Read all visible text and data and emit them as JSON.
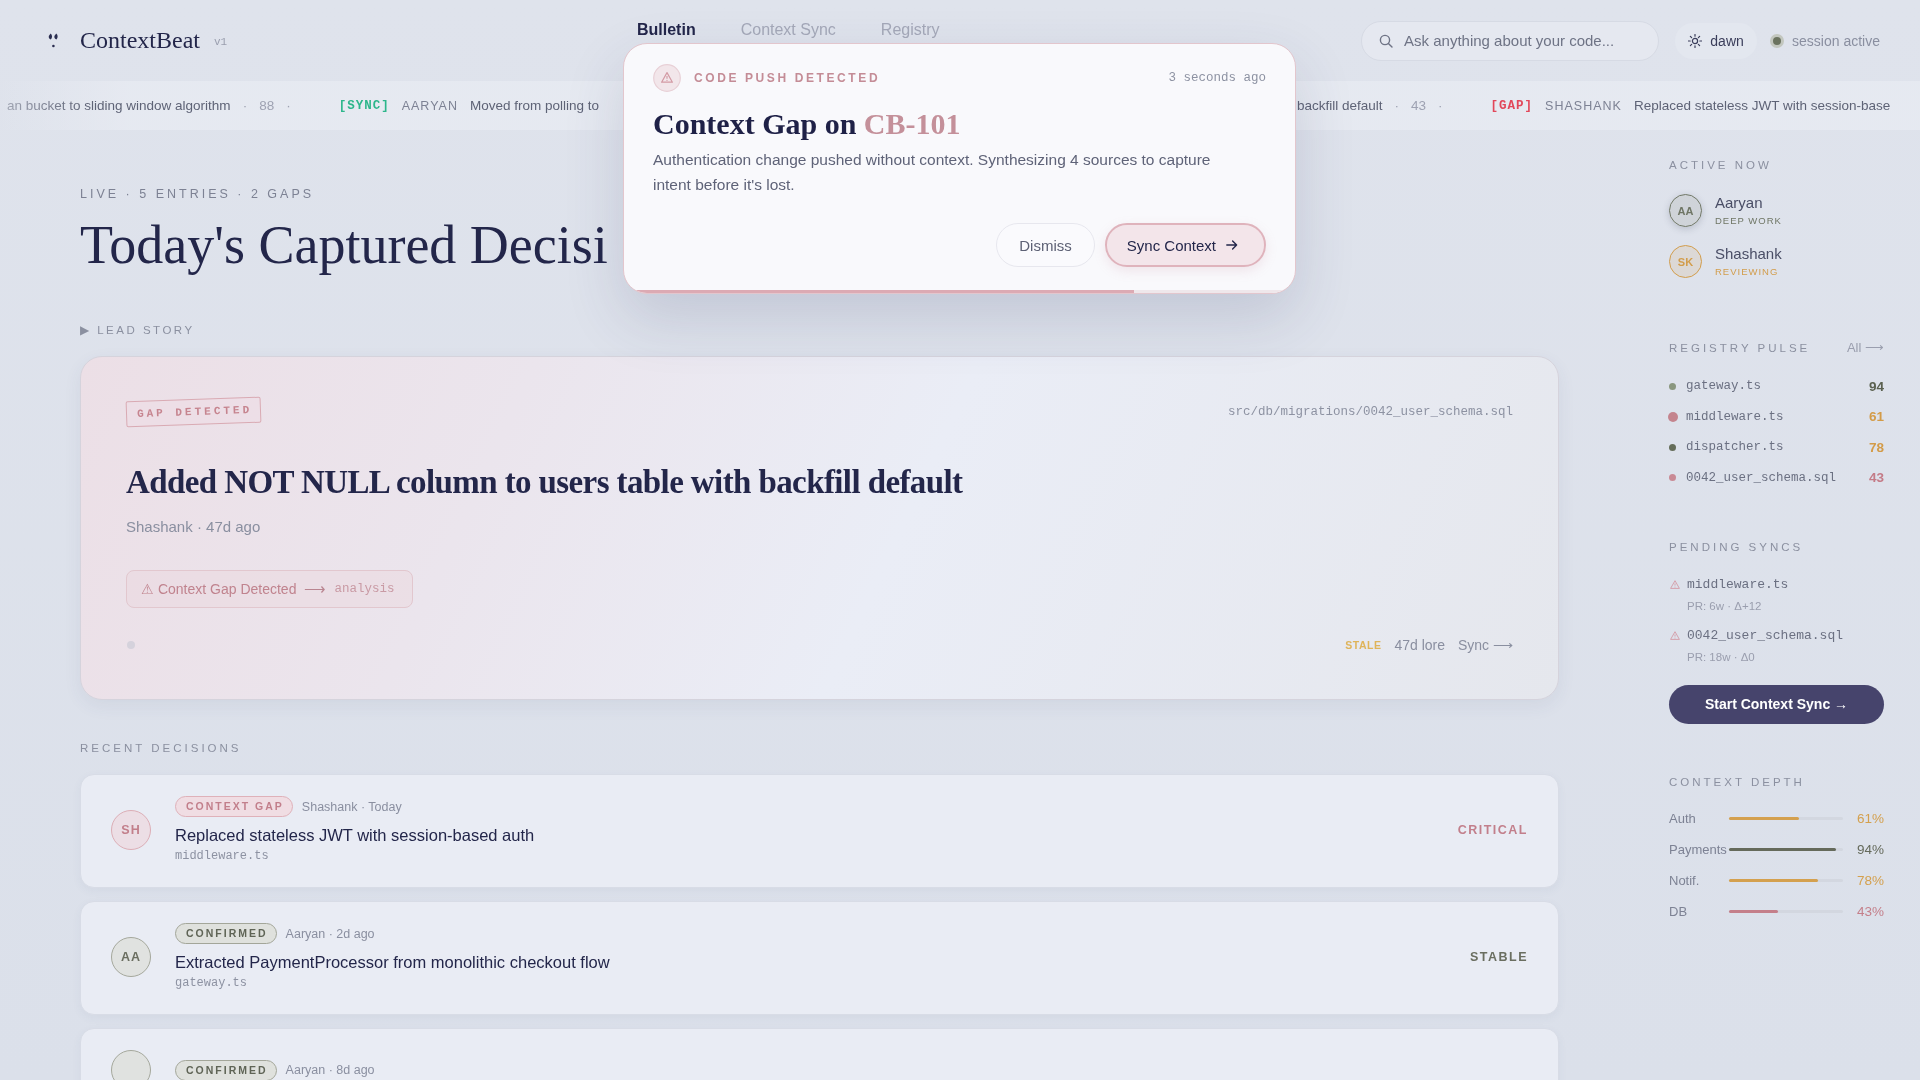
{
  "header": {
    "brand": "ContextBeat",
    "version": "v1",
    "tabs": [
      {
        "label": "Bulletin",
        "selected": true
      },
      {
        "label": "Context Sync",
        "selected": false
      },
      {
        "label": "Registry",
        "selected": false
      }
    ],
    "search": {
      "placeholder": "Ask anything about your code..."
    },
    "theme": {
      "label": "dawn"
    },
    "session": {
      "label": "session active",
      "on": true
    }
  },
  "ticker": {
    "left": [
      {
        "kind": "text",
        "text": "an bucket to sliding window algorithm"
      },
      {
        "kind": "sep",
        "text": "·"
      },
      {
        "kind": "count",
        "text": "88"
      },
      {
        "kind": "sep",
        "text": "·"
      },
      {
        "kind": "tag",
        "text": "[SYNC]",
        "color": "#2db68b"
      },
      {
        "kind": "author",
        "text": "AARYAN"
      },
      {
        "kind": "text",
        "text": "Moved from polling to"
      }
    ],
    "right": [
      {
        "kind": "text",
        "text": "backfill default"
      },
      {
        "kind": "sep",
        "text": "·"
      },
      {
        "kind": "count",
        "text": "43"
      },
      {
        "kind": "sep",
        "text": "·"
      },
      {
        "kind": "tag",
        "text": "[GAP]",
        "color": "#e2475a"
      },
      {
        "kind": "author",
        "text": "SHASHANK"
      },
      {
        "kind": "text",
        "text": "Replaced stateless JWT with session-base"
      }
    ]
  },
  "feed": {
    "live": "LIVE · 5 ENTRIES · 2 GAPS",
    "title": "Today's Captured Decisi",
    "lead_label": "▶ LEAD STORY",
    "lead": {
      "stamp": "GAP DETECTED",
      "path": "src/db/migrations/0042_user_schema.sql",
      "title": "Added NOT NULL column to users table with backfill default",
      "meta": "Shashank · 47d ago",
      "action": {
        "label": "⚠ Context Gap Detected",
        "arrow": "⟶",
        "target": "analysis"
      },
      "status": "STALE",
      "lore": "47d lore",
      "sync": "Sync ⟶"
    },
    "recent_label": "RECENT DECISIONS",
    "rows": [
      {
        "kind": "gap",
        "initials": "SH",
        "badge": "CONTEXT GAP",
        "meta": "Shashank · Today",
        "title": "Replaced stateless JWT with session-based auth",
        "file": "middleware.ts",
        "status": "CRITICAL"
      },
      {
        "kind": "confirmed",
        "initials": "AA",
        "badge": "CONFIRMED",
        "meta": "Aaryan · 2d ago",
        "title": "Extracted PaymentProcessor from monolithic checkout flow",
        "file": "gateway.ts",
        "status": "STABLE"
      },
      {
        "kind": "confirmed",
        "badge": "CONFIRMED",
        "meta": "Aaryan · 8d ago"
      }
    ]
  },
  "sidebar": {
    "active_now": {
      "label": "ACTIVE NOW",
      "people": [
        {
          "initials": "AA",
          "name": "Aaryan",
          "status": "DEEP WORK",
          "color": "#6f7665",
          "highlighted": true
        },
        {
          "initials": "SK",
          "name": "Shashank",
          "status": "REVIEWING",
          "color": "#d29d4c",
          "highlighted": false
        }
      ]
    },
    "registry_pulse": {
      "label": "REGISTRY PULSE",
      "link": "All ⟶",
      "items": [
        {
          "file": "gateway.ts",
          "score": {
            "text": "94",
            "color": "#5b6150"
          },
          "color": "#8a977f",
          "pulse": false
        },
        {
          "file": "middleware.ts",
          "score": {
            "text": "61",
            "color": "#d39b48"
          },
          "color": "#c4848e",
          "pulse": true
        },
        {
          "file": "dispatcher.ts",
          "score": {
            "text": "78",
            "color": "#d39b48"
          },
          "color": "#656d5a",
          "pulse": false
        },
        {
          "file": "0042_user_schema.sql",
          "score": {
            "text": "43",
            "color": "#c47b87"
          },
          "color": "#c98a95",
          "pulse": false
        }
      ]
    },
    "pending_syncs": {
      "label": "PENDING SYNCS",
      "items": [
        {
          "file": "middleware.ts",
          "meta": "PR: 6w · Δ+12"
        },
        {
          "file": "0042_user_schema.sql",
          "meta": "PR: 18w · Δ0"
        }
      ]
    },
    "start_button": "Start Context Sync →",
    "context_depth": {
      "label": "CONTEXT DEPTH",
      "items": [
        {
          "name": "Auth",
          "level": 0.61,
          "reading": "61%",
          "color": "#d4a04e"
        },
        {
          "name": "Payments",
          "level": 0.94,
          "reading": "94%",
          "color": "#656a5b"
        },
        {
          "name": "Notif.",
          "level": 0.78,
          "reading": "78%",
          "color": "#d4a04e"
        },
        {
          "name": "DB",
          "level": 0.43,
          "reading": "43%",
          "color": "#c47f8a"
        }
      ]
    }
  },
  "alert": {
    "kicker": "CODE PUSH DETECTED",
    "time": "3 seconds ago",
    "title": "Context Gap on",
    "ticket": "CB-101",
    "body": "Authentication change pushed without context. Synthesizing 4 sources to capture intent before it's lost.",
    "buttons": [
      {
        "label": "Dismiss",
        "kind": "secondary"
      },
      {
        "label": "Sync Context",
        "kind": "primary"
      }
    ],
    "level": 0.76
  }
}
